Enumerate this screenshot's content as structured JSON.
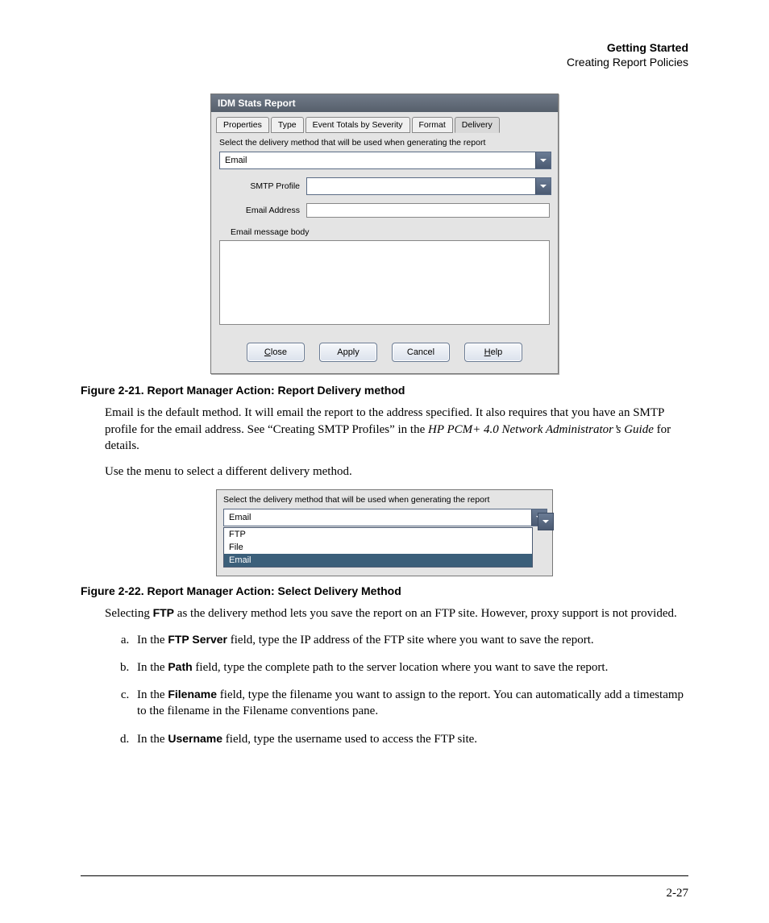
{
  "header": {
    "title": "Getting Started",
    "subtitle": "Creating Report Policies"
  },
  "dialog1": {
    "title": "IDM Stats Report",
    "tabs": [
      "Properties",
      "Type",
      "Event Totals by Severity",
      "Format",
      "Delivery"
    ],
    "instruction": "Select the delivery method that will be used when generating the report",
    "combo_value": "Email",
    "smtp_label": "SMTP Profile",
    "email_label": "Email Address",
    "msg_label": "Email message body",
    "buttons": {
      "close": "Close",
      "apply": "Apply",
      "cancel": "Cancel",
      "help": "Help"
    }
  },
  "caption1": "Figure 2-21. Report Manager Action: Report Delivery method",
  "para1_a": "Email is the default method. It will email the report to the address specified. It also requires that you have an SMTP profile for the email address. See “Creating SMTP Profiles” in the ",
  "para1_italic": "HP PCM+ 4.0 Network Administrator’s Guide",
  "para1_b": " for details.",
  "para2": "Use the menu to select a different delivery method.",
  "dialog2": {
    "instruction": "Select the delivery method that will be used when generating the report",
    "combo_value": "Email",
    "options": [
      "FTP",
      "File",
      "Email"
    ]
  },
  "caption2": "Figure 2-22. Report Manager Action: Select Delivery Method",
  "para3_a": "Selecting ",
  "para3_bold": "FTP",
  "para3_b": " as the delivery method lets you save the report on an FTP site. However, proxy support is not provided.",
  "list": {
    "a_pre": "In the ",
    "a_bold": "FTP Server",
    "a_post": " field, type the IP address of the FTP site where you want to save the report.",
    "b_pre": "In the ",
    "b_bold": "Path",
    "b_post": " field, type the complete path to the server location where you want to save the report.",
    "c_pre": "In the ",
    "c_bold": "Filename",
    "c_post": " field, type the filename you want to assign to the report. You can automatically add a timestamp to the filename in the Filename conventions pane.",
    "d_pre": "In the ",
    "d_bold": "Username",
    "d_post": " field, type the username used to access the FTP site."
  },
  "page_number": "2-27"
}
